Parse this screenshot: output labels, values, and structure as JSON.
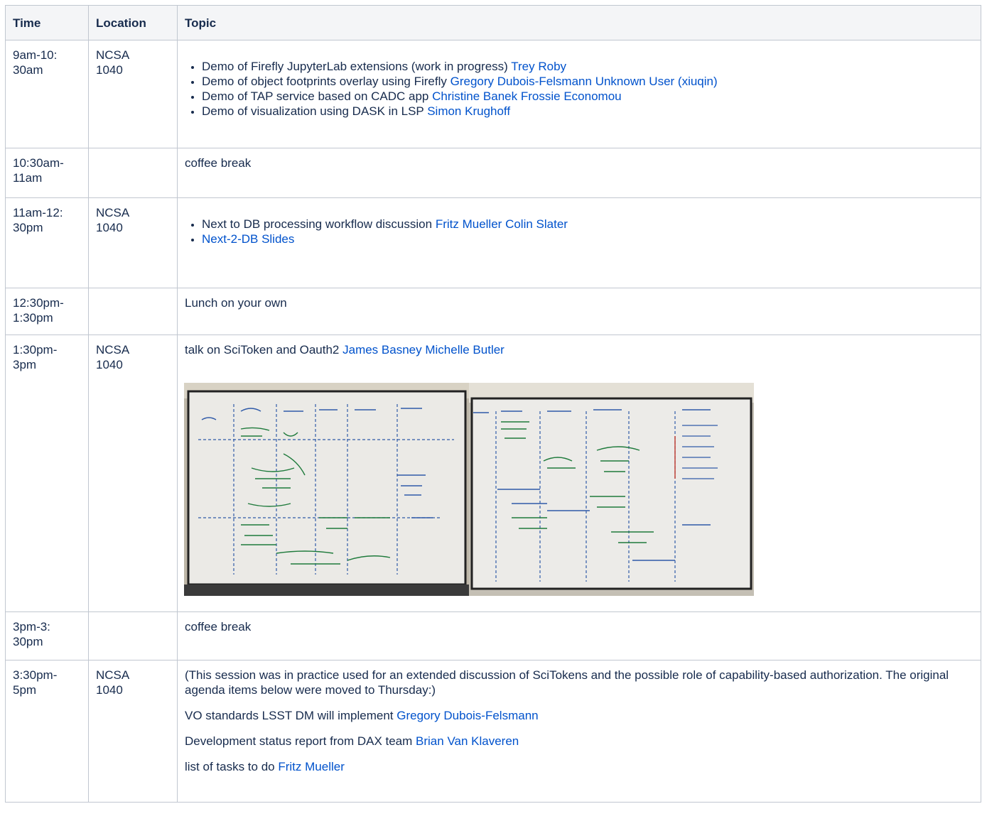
{
  "table": {
    "headers": [
      "Time",
      "Location",
      "Topic"
    ],
    "rows": [
      {
        "time": "9am-10:\n30am",
        "location": "NCSA\n1040",
        "items": [
          {
            "text": "Demo of Firefly JupyterLab extensions (work in progress)",
            "links": [
              "Trey Roby"
            ]
          },
          {
            "text": "Demo of object footprints overlay using Firefly",
            "links": [
              "Gregory Dubois-Felsmann",
              "Unknown User (xiuqin)"
            ]
          },
          {
            "text": "Demo of TAP service based on CADC app",
            "links": [
              "Christine Banek",
              "Frossie Economou"
            ]
          },
          {
            "text": "Demo of visualization using DASK in LSP",
            "links": [
              "Simon Krughoff"
            ]
          }
        ]
      },
      {
        "time": "10:30am-\n11am",
        "location": "",
        "topic": "coffee break"
      },
      {
        "time": "11am-12:\n30pm",
        "location": "NCSA\n1040",
        "items": [
          {
            "text": "Next to DB processing workflow discussion",
            "links": [
              "Fritz Mueller",
              "Colin Slater"
            ]
          },
          {
            "text": "",
            "links": [
              "Next-2-DB Slides"
            ]
          }
        ]
      },
      {
        "time": "12:30pm-\n1:30pm",
        "location": "",
        "topic": "Lunch on your own"
      },
      {
        "time": "1:30pm-\n3pm",
        "location": "NCSA\n1040",
        "topic": "talk on SciToken and Oauth2",
        "links": [
          "James Basney",
          "Michelle Butler"
        ]
      },
      {
        "time": "3pm-3:\n30pm",
        "location": "",
        "topic": "coffee break"
      },
      {
        "time": "3:30pm-\n5pm",
        "location": "NCSA\n1040",
        "paragraphs": [
          {
            "text": "(This session was in practice used for an extended discussion of SciTokens and the possible role of capability-based authorization. The original agenda items below were moved to Thursday:)",
            "links": []
          },
          {
            "text": "VO standards LSST DM will implement",
            "links": [
              "Gregory Dubois-Felsmann"
            ]
          },
          {
            "text": "Development status report from DAX team",
            "links": [
              "Brian Van Klaveren"
            ]
          },
          {
            "text": "list of tasks to do",
            "links": [
              "Fritz Mueller"
            ]
          }
        ]
      }
    ]
  },
  "colors": {
    "link": "#0052cc",
    "header_bg": "#f4f5f7",
    "border": "#c1c7d0",
    "text": "#172b4d"
  }
}
